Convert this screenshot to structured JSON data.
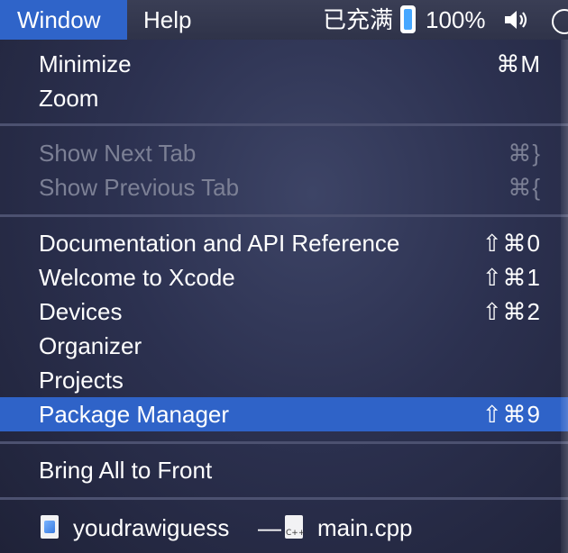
{
  "menubar": {
    "window": "Window",
    "help": "Help"
  },
  "status": {
    "charge": "已充满",
    "percent": "100%",
    "battery_level": 1.0
  },
  "menu": {
    "items": [
      {
        "label": "Minimize",
        "shortcut": "⌘M"
      },
      {
        "label": "Zoom",
        "shortcut": ""
      },
      {
        "label": "Show Next Tab",
        "shortcut": "⌘}",
        "disabled": true
      },
      {
        "label": "Show Previous Tab",
        "shortcut": "⌘{",
        "disabled": true
      },
      {
        "label": "Documentation and API Reference",
        "shortcut": "⇧⌘0"
      },
      {
        "label": "Welcome to Xcode",
        "shortcut": "⇧⌘1"
      },
      {
        "label": "Devices",
        "shortcut": "⇧⌘2"
      },
      {
        "label": "Organizer",
        "shortcut": ""
      },
      {
        "label": "Projects",
        "shortcut": ""
      },
      {
        "label": "Package Manager",
        "shortcut": "⇧⌘9",
        "selected": true
      },
      {
        "label": "Bring All to Front",
        "shortcut": ""
      }
    ],
    "window_entry": {
      "project": "youdrawiguess",
      "separator": "—",
      "file": "main.cpp",
      "file_icon_tag": "C++"
    }
  },
  "colors": {
    "accent": "#2f63c8",
    "disabled_text": "#7c8095",
    "battery_fill": "#46a7ff"
  }
}
